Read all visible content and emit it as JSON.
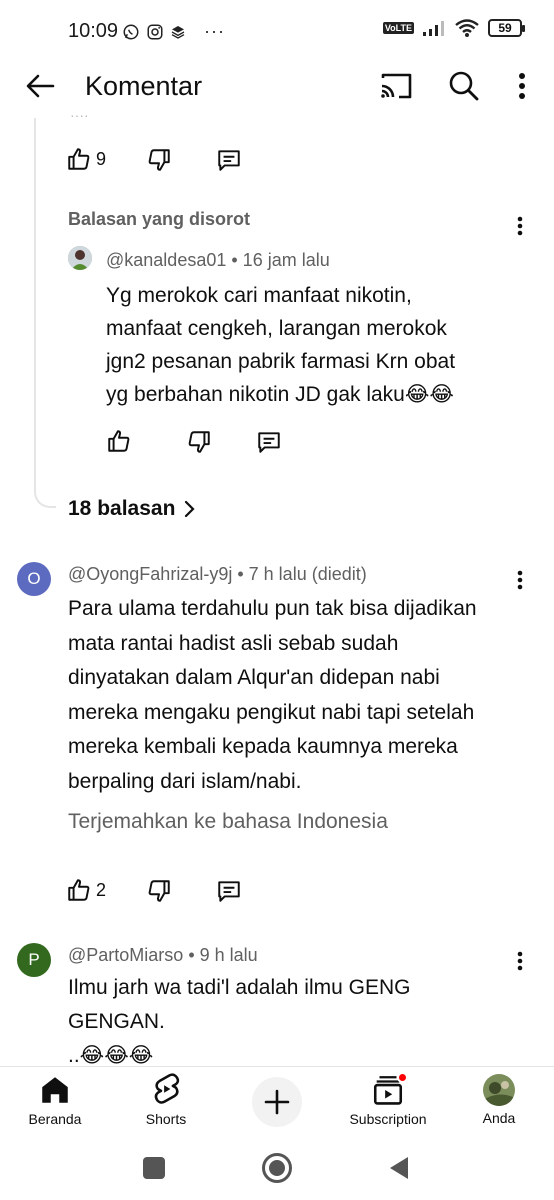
{
  "status_bar": {
    "time": "10:09",
    "network": "VoLTE",
    "battery": "59"
  },
  "header": {
    "title": "Komentar"
  },
  "parent_actions": {
    "like_count": "9"
  },
  "highlighted": {
    "section_label": "Balasan yang disorot",
    "author": "@kanaldesa01",
    "time": "• 16 jam lalu",
    "text_lines": [
      "Yg merokok cari manfaat nikotin,",
      "manfaat cengkeh, larangan merokok",
      "jgn2 pesanan pabrik farmasi Krn obat",
      "yg berbahan nikotin JD gak laku😂😂"
    ]
  },
  "replies_link": {
    "label": "18 balasan"
  },
  "comments": [
    {
      "avatar_letter": "O",
      "avatar_color": "#5c6bc0",
      "author": "@OyongFahrizal-y9j",
      "time": "• 7 h lalu (diedit)",
      "text_lines": [
        "Para ulama terdahulu pun tak bisa dijadikan",
        "mata rantai hadist asli sebab sudah",
        "dinyatakan dalam Alqur'an didepan nabi",
        "mereka mengaku pengikut nabi tapi setelah",
        "mereka kembali kepada kaumnya mereka",
        "berpaling dari islam/nabi."
      ],
      "translate": "Terjemahkan ke bahasa Indonesia",
      "like_count": "2"
    },
    {
      "avatar_letter": "P",
      "avatar_color": "#33691e",
      "author": "@PartoMiarso",
      "time": "• 9 h lalu",
      "text_lines": [
        "Ilmu jarh wa tadi'l adalah ilmu GENG",
        "GENGAN.",
        "..😂😂😂"
      ]
    }
  ],
  "bottom_nav": {
    "home": "Beranda",
    "shorts": "Shorts",
    "subscription": "Subscription",
    "you": "Anda"
  },
  "colors": {
    "accent_red": "#ff0000",
    "text": "#0f0f0f",
    "muted": "#606060"
  }
}
